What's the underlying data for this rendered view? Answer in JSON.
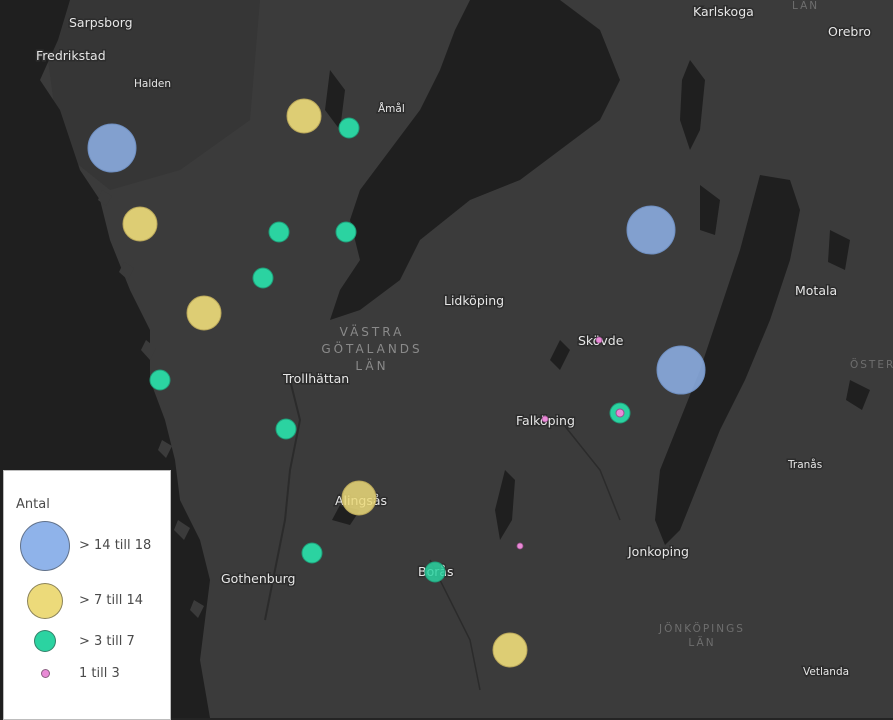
{
  "map": {
    "colors": {
      "land": "#3b3b3b",
      "water": "#1f1f1f",
      "label": "#e6e6e6",
      "region_label": "#8a8a8a"
    },
    "places": [
      {
        "id": "sarpsborg",
        "name": "Sarpsborg"
      },
      {
        "id": "fredrikstad",
        "name": "Fredrikstad"
      },
      {
        "id": "halden",
        "name": "Halden"
      },
      {
        "id": "amal",
        "name": "Åmål"
      },
      {
        "id": "karlskoga",
        "name": "Karlskoga"
      },
      {
        "id": "orebro",
        "name": "Orebro"
      },
      {
        "id": "lidkoping",
        "name": "Lidköping"
      },
      {
        "id": "motala",
        "name": "Motala"
      },
      {
        "id": "skovde",
        "name": "Skövde"
      },
      {
        "id": "trollhattan",
        "name": "Trollhättan"
      },
      {
        "id": "falkoping",
        "name": "Falköping"
      },
      {
        "id": "tranas",
        "name": "Tranås"
      },
      {
        "id": "alingsas",
        "name": "Alingsås"
      },
      {
        "id": "boras",
        "name": "Borås"
      },
      {
        "id": "jonkoping",
        "name": "Jonkoping"
      },
      {
        "id": "gothenburg",
        "name": "Gothenburg"
      },
      {
        "id": "vetlanda",
        "name": "Vetlanda"
      }
    ],
    "regions": [
      {
        "id": "vastra-gotalands-lan",
        "lines": [
          "VÄSTRA",
          "GÖTALANDS",
          "LÄN"
        ]
      },
      {
        "id": "jonkopings-lan",
        "lines": [
          "JÖNKÖPINGS",
          "LÄN"
        ]
      },
      {
        "id": "oster-partial",
        "lines": [
          "ÖSTER"
        ]
      },
      {
        "id": "lan-partial",
        "lines": [
          "LÄN"
        ]
      }
    ]
  },
  "legend": {
    "title": "Antal",
    "classes": [
      {
        "id": "xl",
        "label": "> 14 till 18",
        "color": "#8fb3ea"
      },
      {
        "id": "l",
        "label": "> 7 till 14",
        "color": "#ecda7a"
      },
      {
        "id": "m",
        "label": "> 3 till 7",
        "color": "#2bd3a1"
      },
      {
        "id": "s",
        "label": "1 till 3",
        "color": "#e98ad6"
      }
    ]
  }
}
